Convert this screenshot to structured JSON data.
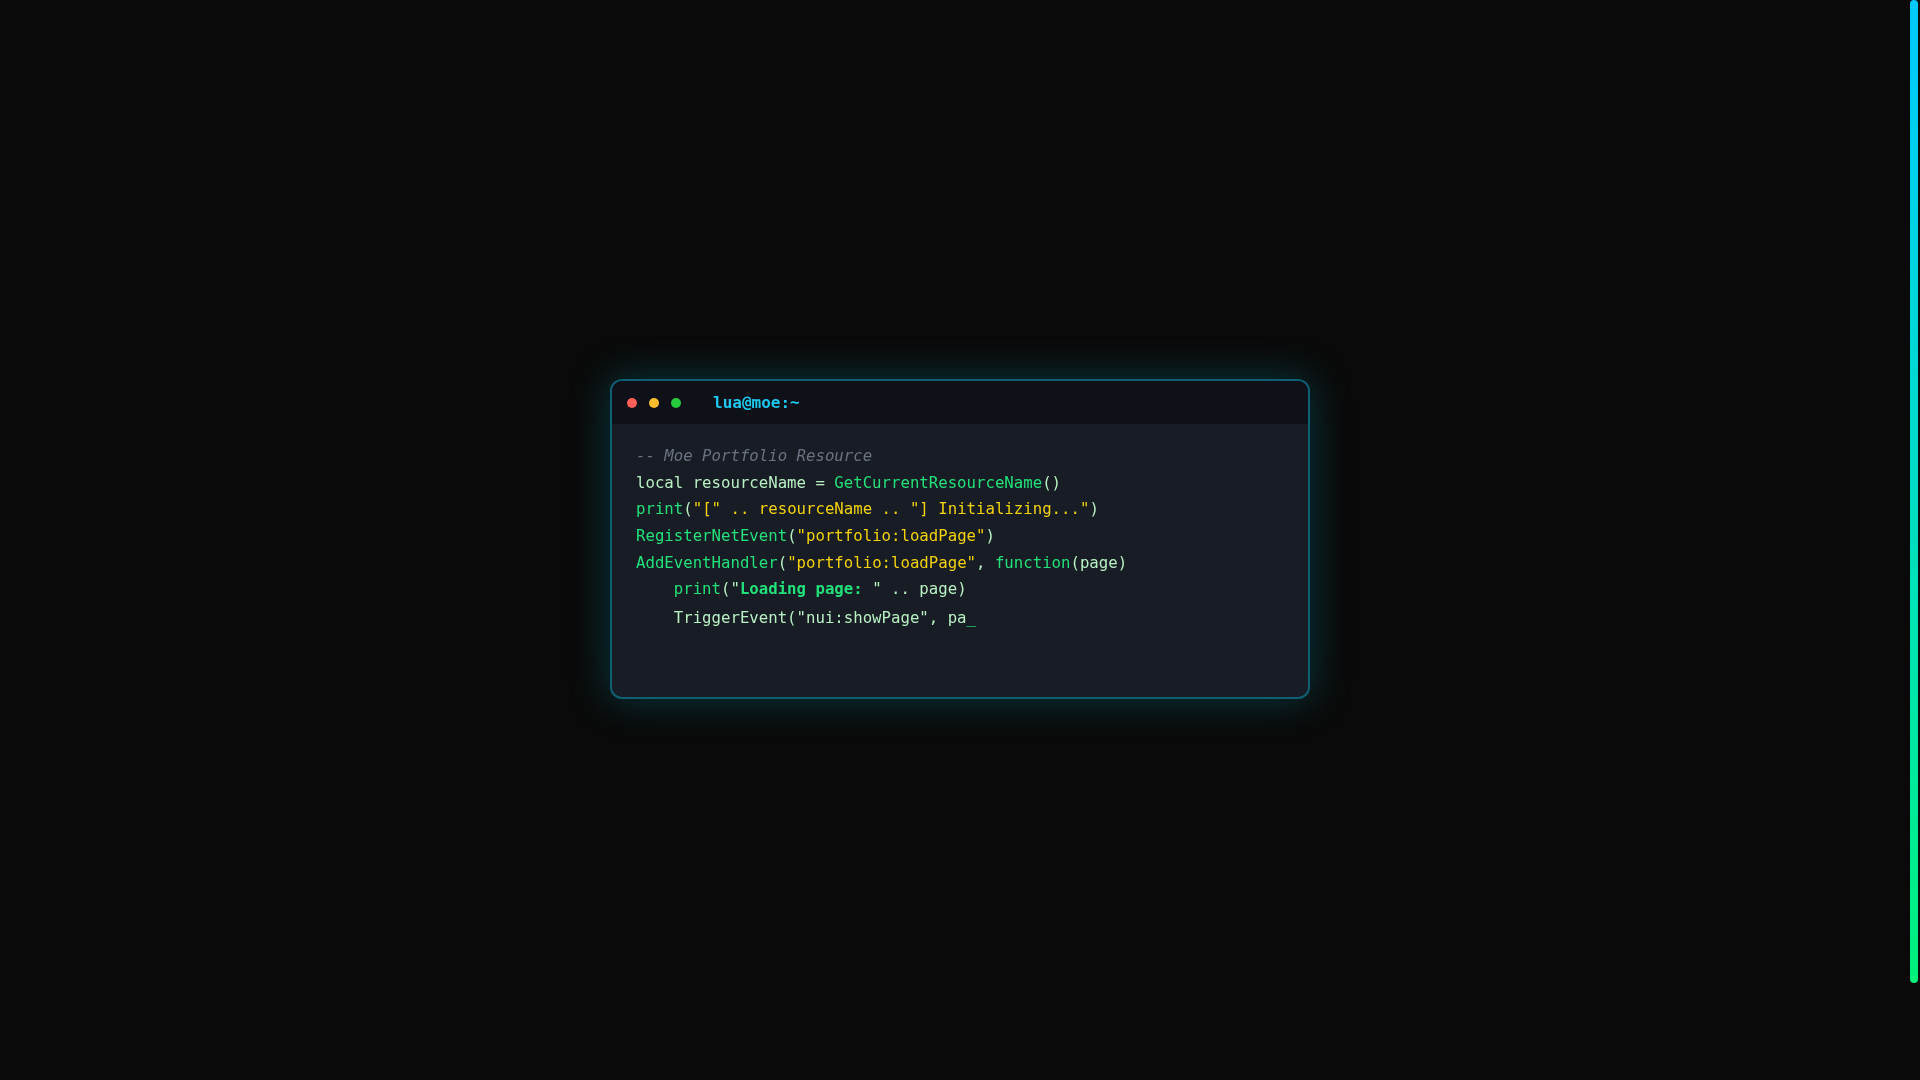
{
  "window": {
    "title": "lua@moe:~"
  },
  "code_lines": [
    {
      "indented": false,
      "tokens": [
        {
          "kind": "comment",
          "text": "-- Moe Portfolio Resource"
        }
      ]
    },
    {
      "indented": false,
      "tokens": [
        {
          "kind": "plain",
          "text": "local resourceName = "
        },
        {
          "kind": "func",
          "text": "GetCurrentResourceName"
        },
        {
          "kind": "plain",
          "text": "()"
        }
      ]
    },
    {
      "indented": false,
      "tokens": [
        {
          "kind": "func",
          "text": "print"
        },
        {
          "kind": "plain",
          "text": "("
        },
        {
          "kind": "string",
          "text": "\"[\" .. resourceName .. \"] Initializing...\""
        },
        {
          "kind": "plain",
          "text": ")"
        }
      ]
    },
    {
      "indented": false,
      "tokens": [
        {
          "kind": "func",
          "text": "RegisterNetEvent"
        },
        {
          "kind": "plain",
          "text": "("
        },
        {
          "kind": "string",
          "text": "\"portfolio:loadPage\""
        },
        {
          "kind": "plain",
          "text": ")"
        }
      ]
    },
    {
      "indented": false,
      "tokens": [
        {
          "kind": "func",
          "text": "AddEventHandler"
        },
        {
          "kind": "plain",
          "text": "("
        },
        {
          "kind": "string",
          "text": "\"portfolio:loadPage\""
        },
        {
          "kind": "plain",
          "text": ", "
        },
        {
          "kind": "func",
          "text": "function"
        },
        {
          "kind": "plain",
          "text": "(page)"
        }
      ]
    },
    {
      "indented": true,
      "tokens": [
        {
          "kind": "func",
          "text": "print"
        },
        {
          "kind": "plain",
          "text": "(\""
        },
        {
          "kind": "bold",
          "text": "Loading page: "
        },
        {
          "kind": "plain",
          "text": "\" .. page)"
        }
      ]
    },
    {
      "indented": true,
      "tokens": [
        {
          "kind": "plain",
          "text": "TriggerEvent(\"nui:showPage\", pa"
        },
        {
          "kind": "cursor",
          "text": "_"
        }
      ]
    }
  ]
}
